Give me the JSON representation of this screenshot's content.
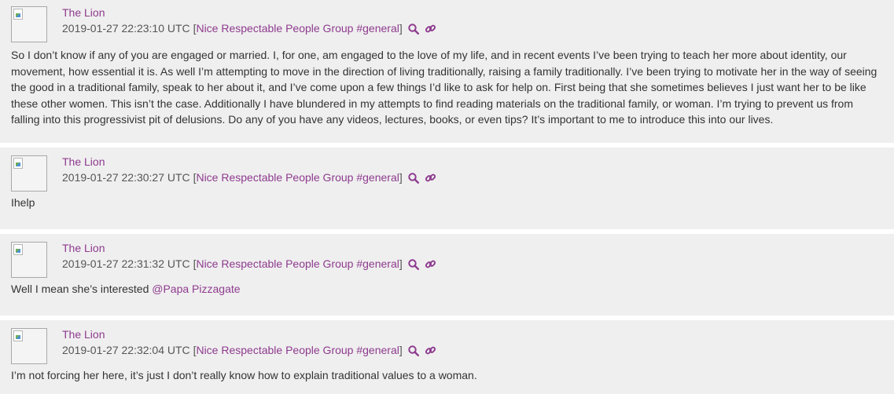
{
  "messages": [
    {
      "author": "The Lion",
      "timestamp": "2019-01-27 22:23:10 UTC",
      "bracket_open": "[",
      "group": "Nice Respectable People Group #general",
      "bracket_close": "]",
      "text": "So I don’t know if any of you are engaged or married. I, for one, am engaged to the love of my life, and in recent events I’ve been trying to teach her more about identity, our movement, how essential it is. As well I’m attempting to move in the direction of living traditionally, raising a family traditionally. I’ve been trying to motivate her in the way of seeing the good in a traditional family, speak to her about it, and I’ve come upon a few things I’d like to ask for help on. First being that she sometimes believes I just want her to be like these other women. This isn’t the case. Additionally I have blundered in my attempts to find reading materials on the traditional family, or woman. I’m trying to prevent us from falling into this progressivist pit of delusions. Do any of you have any videos, lectures, books, or even tips? It’s important to me to introduce this into our lives."
    },
    {
      "author": "The Lion",
      "timestamp": "2019-01-27 22:30:27 UTC",
      "bracket_open": "[",
      "group": "Nice Respectable People Group #general",
      "bracket_close": "]",
      "text": "Ihelp"
    },
    {
      "author": "The Lion",
      "timestamp": "2019-01-27 22:31:32 UTC",
      "bracket_open": "[",
      "group": "Nice Respectable People Group #general",
      "bracket_close": "]",
      "text": "Well I mean she’s interested ",
      "mention": "@Papa Pizzagate"
    },
    {
      "author": "The Lion",
      "timestamp": "2019-01-27 22:32:04 UTC",
      "bracket_open": "[",
      "group": "Nice Respectable People Group #general",
      "bracket_close": "]",
      "text": "I’m not forcing her here, it’s just I don’t really know how to explain traditional values to a woman."
    }
  ],
  "icons": {
    "search": "search-icon",
    "link": "link-icon",
    "avatar": "broken-image-icon"
  },
  "colors": {
    "accent": "#8e3b8e",
    "background": "#efefef",
    "text": "#333333"
  }
}
